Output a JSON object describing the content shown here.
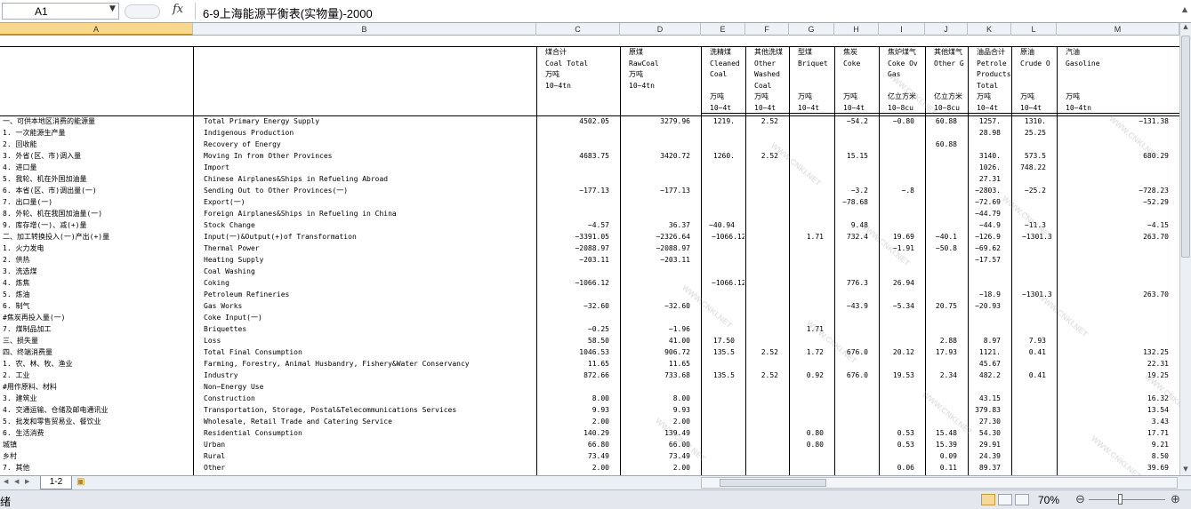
{
  "formula_bar": {
    "name_box": "A1",
    "fx": "fx",
    "formula": "6-9上海能源平衡表(实物量)-2000"
  },
  "col_letters": [
    "A",
    "B",
    "C",
    "D",
    "E",
    "F",
    "G",
    "H",
    "I",
    "J",
    "K",
    "L",
    "M"
  ],
  "watermark": "WWW.CNKI.NET",
  "header": {
    "C": "煤合计\nCoal Total\n万吨\n10~4tn",
    "D": "原煤\nRawCoal\n万吨\n10~4tn",
    "E": "洗精煤\nCleaned\nCoal\n\n万吨\n10~4t",
    "F": "其他洗煤\nOther\nWashed\nCoal\n万吨\n10~4t",
    "G": "型煤\nBriquet\n\n\n万吨\n10~4t",
    "H": "焦炭\nCoke\n\n\n万吨\n10~4t",
    "I": "焦炉煤气\nCoke Ov\nGas\n\n亿立方米\n10~8cu",
    "J": "其他煤气\nOther G\n\n\n亿立方米\n10~8cu",
    "K": "油品合计\nPetrole\nProducts\nTotal\n万吨\n10~4t",
    "L": "原油\nCrude O\n\n\n万吨\n10~4t",
    "M": "汽油\nGasoline\n\n\n万吨\n10~4tn"
  },
  "rows": [
    [
      "一、可供本地区消费的能源量",
      "Total Primary Energy Supply",
      "4502.05",
      "3279.96",
      "1219.",
      "2.52",
      "",
      "−54.2",
      "−0.80",
      "60.88",
      "1257.",
      "1310.",
      "−131.38"
    ],
    [
      "  1. 一次能源生产量",
      "Indigenous Production",
      "",
      "",
      "",
      "",
      "",
      "",
      "",
      "",
      "28.98",
      "25.25",
      ""
    ],
    [
      "  2. 回收能",
      "Recovery of Energy",
      "",
      "",
      "",
      "",
      "",
      "",
      "",
      "60.88",
      "",
      "",
      ""
    ],
    [
      "  3. 外省(区、市)调入量",
      "Moving In from Other Provinces",
      "4683.75",
      "3420.72",
      "1260.",
      "2.52",
      "",
      "15.15",
      "",
      "",
      "3140.",
      "573.5",
      "680.29"
    ],
    [
      "  4. 进口量",
      "Import",
      "",
      "",
      "",
      "",
      "",
      "",
      "",
      "",
      "1026.",
      "748.22",
      ""
    ],
    [
      "  5. 我轮、机在外国加油量",
      "Chinese Airplanes&Ships in Refueling Abroad",
      "",
      "",
      "",
      "",
      "",
      "",
      "",
      "",
      "27.31",
      "",
      ""
    ],
    [
      "  6. 本省(区、市)调出量(一)",
      "Sending Out to Other Provinces(一)",
      "−177.13",
      "−177.13",
      "",
      "",
      "",
      "−3.2",
      "−.8",
      "",
      "−2803.",
      "−25.2",
      "−728.23"
    ],
    [
      "  7. 出口量(一)",
      "Export(一)",
      "",
      "",
      "",
      "",
      "",
      "−78.68",
      "",
      "",
      "−72.69",
      "",
      "−52.29"
    ],
    [
      "  8. 外轮、机在我国加油量(一)",
      "Foreign Airplanes&Ships in Refueling in China",
      "",
      "",
      "",
      "",
      "",
      "",
      "",
      "",
      "−44.79",
      "",
      ""
    ],
    [
      "  9. 库存增(一)、减(+)量",
      "Stock Change",
      "−4.57",
      "36.37",
      "−40.94",
      "",
      "",
      "9.48",
      "",
      "",
      "−44.9",
      "−11.3",
      "−4.15"
    ],
    [
      "二、加工转换投入(一)产出(+)量",
      "Input(一)&Output(+)of Transformation",
      "−3391.05",
      "−2326.64",
      "−1066.12",
      "",
      "1.71",
      "732.4",
      "19.69",
      "−40.1",
      "−126.9",
      "−1301.3",
      "263.70"
    ],
    [
      "  1. 火力发电",
      "Thermal Power",
      "−2088.97",
      "−2088.97",
      "",
      "",
      "",
      "",
      "−1.91",
      "−50.8",
      "−69.62",
      "",
      ""
    ],
    [
      "  2. 供热",
      "Heating Supply",
      "−203.11",
      "−203.11",
      "",
      "",
      "",
      "",
      "",
      "",
      "−17.57",
      "",
      ""
    ],
    [
      "  3. 洗选煤",
      "Coal Washing",
      "",
      "",
      "",
      "",
      "",
      "",
      "",
      "",
      "",
      "",
      ""
    ],
    [
      "  4. 炼焦",
      "Coking",
      "−1066.12",
      "",
      "−1066.12",
      "",
      "",
      "776.3",
      "26.94",
      "",
      "",
      "",
      ""
    ],
    [
      "  5. 炼油",
      "Petroleum Refineries",
      "",
      "",
      "",
      "",
      "",
      "",
      "",
      "",
      "−18.9",
      "−1301.3",
      "263.70"
    ],
    [
      "  6. 制气",
      "Gas Works",
      "−32.60",
      "−32.60",
      "",
      "",
      "",
      "−43.9",
      "−5.34",
      "20.75",
      "−20.93",
      "",
      ""
    ],
    [
      "    #焦炭再投入量(一)",
      "  Coke Input(一)",
      "",
      "",
      "",
      "",
      "",
      "",
      "",
      "",
      "",
      "",
      ""
    ],
    [
      "  7. 煤制品加工",
      "Briquettes",
      "−0.25",
      "−1.96",
      "",
      "",
      "1.71",
      "",
      "",
      "",
      "",
      "",
      ""
    ],
    [
      "三、损失量",
      "Loss",
      "58.50",
      "41.00",
      "17.50",
      "",
      "",
      "",
      "",
      "2.88",
      "8.97",
      "7.93",
      ""
    ],
    [
      "四、终端消费量",
      "Total Final Consumption",
      "1046.53",
      "906.72",
      "135.5",
      "2.52",
      "1.72",
      "676.0",
      "20.12",
      "17.93",
      "1121.",
      "0.41",
      "132.25"
    ],
    [
      "  1. 农、林、牧、渔业",
      "Farming, Forestry, Animal Husbandry, Fishery&Water Conservancy",
      "11.65",
      "11.65",
      "",
      "",
      "",
      "",
      "",
      "",
      "45.67",
      "",
      "22.31"
    ],
    [
      "  2. 工业",
      "Industry",
      "872.66",
      "733.68",
      "135.5",
      "2.52",
      "0.92",
      "676.0",
      "19.53",
      "2.34",
      "482.2",
      "0.41",
      "19.25"
    ],
    [
      "    #用作原料、材料",
      "  Non−Energy Use",
      "",
      "",
      "",
      "",
      "",
      "",
      "",
      "",
      "",
      "",
      ""
    ],
    [
      "  3. 建筑业",
      "Construction",
      "8.00",
      "8.00",
      "",
      "",
      "",
      "",
      "",
      "",
      "43.15",
      "",
      "16.32"
    ],
    [
      "  4. 交通运输、仓储及邮电通讯业",
      "Transportation, Storage, Postal&Telecommunications Services",
      "9.93",
      "9.93",
      "",
      "",
      "",
      "",
      "",
      "",
      "379.83",
      "",
      "13.54"
    ],
    [
      "  5. 批发和零售贸易业、餐饮业",
      "Wholesale, Retail Trade and Catering Service",
      "2.00",
      "2.00",
      "",
      "",
      "",
      "",
      "",
      "",
      "27.30",
      "",
      "3.43"
    ],
    [
      "  6. 生活消费",
      "Residential Consumption",
      "140.29",
      "139.49",
      "",
      "",
      "0.80",
      "",
      "0.53",
      "15.48",
      "54.30",
      "",
      "17.71"
    ],
    [
      "    城镇",
      "  Urban",
      "66.80",
      "66.00",
      "",
      "",
      "0.80",
      "",
      "0.53",
      "15.39",
      "29.91",
      "",
      "9.21"
    ],
    [
      "    乡村",
      "  Rural",
      "73.49",
      "73.49",
      "",
      "",
      "",
      "",
      "",
      "0.09",
      "24.39",
      "",
      "8.50"
    ],
    [
      "  7. 其他",
      "Other",
      "2.00",
      "2.00",
      "",
      "",
      "",
      "",
      "0.06",
      "0.11",
      "89.37",
      "",
      "39.69"
    ]
  ],
  "sheet_tab": "1-2",
  "status": {
    "ready": "绪",
    "zoom": "70%"
  }
}
